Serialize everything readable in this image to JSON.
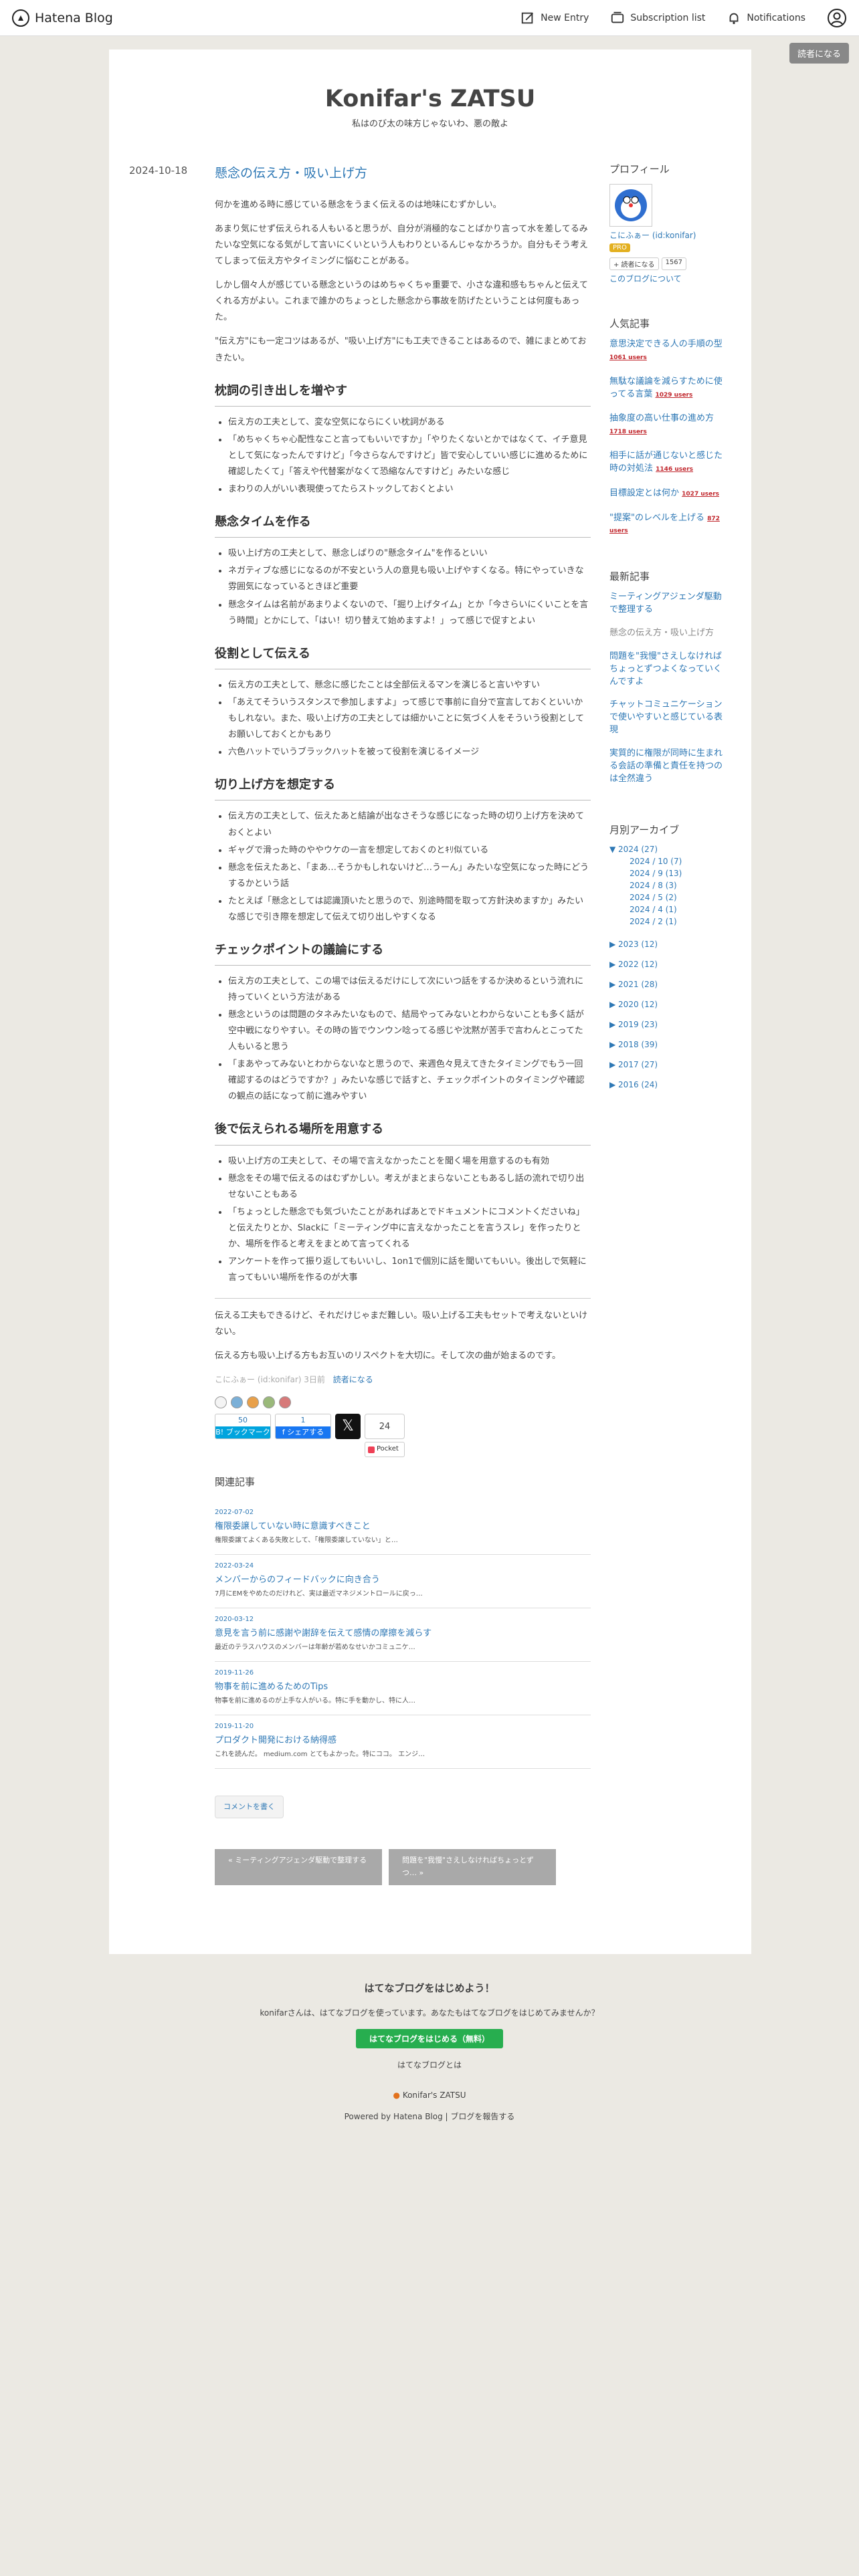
{
  "topbar": {
    "logo": "Hatena Blog",
    "new_entry": "New Entry",
    "subscription": "Subscription list",
    "notifications": "Notifications"
  },
  "read_button": "読者になる",
  "blog": {
    "title": "Konifar's ZATSU",
    "description": "私はのび太の味方じゃないわ、悪の敵よ"
  },
  "article": {
    "date": "2024-10-18",
    "title": "懸念の伝え方・吸い上げ方",
    "intro": [
      "何かを進める時に感じている懸念をうまく伝えるのは地味にむずかしい。",
      "あまり気にせず伝えられる人もいると思うが、自分が消極的なことばかり言って水を差してるみたいな空気になる気がして言いにくいという人もわりといるんじゃなかろうか。自分もそう考えてしまって伝え方やタイミングに悩むことがある。",
      "しかし個々人が感じている懸念というのはめちゃくちゃ重要で、小さな違和感もちゃんと伝えてくれる方がよい。これまで誰かのちょっとした懸念から事故を防げたということは何度もあった。",
      "\"伝え方\"にも一定コツはあるが、\"吸い上げ方\"にも工夫できることはあるので、雑にまとめておきたい。"
    ],
    "sections": [
      {
        "heading": "枕詞の引き出しを増やす",
        "items": [
          "伝え方の工夫として、変な空気にならにくい枕詞がある",
          "「めちゃくちゃ心配性なこと言ってもいいですか」「やりたくないとかではなくて、イチ意見として気になったんですけど」「今さらなんですけど」皆で安心していい感じに進めるために確認したくて」「答えや代替案がなくて恐縮なんですけど」みたいな感じ",
          "まわりの人がいい表現使ってたらストックしておくとよい"
        ]
      },
      {
        "heading": "懸念タイムを作る",
        "items": [
          "吸い上げ方の工夫として、懸念しばりの\"懸念タイム\"を作るといい",
          "ネガティブな感じになるのが不安という人の意見も吸い上げやすくなる。特にやっていきな雰囲気になっているときほど重要",
          "懸念タイムは名前があまりよくないので、「掘り上げタイム」とか「今さらいにくいことを言う時間」とかにして、「はい！切り替えて始めますよ！」って感じで促すとよい"
        ]
      },
      {
        "heading": "役割として伝える",
        "items": [
          "伝え方の工夫として、懸念に感じたことは全部伝えるマンを演じると言いやすい",
          "「あえてそういうスタンスで参加しますよ」って感じで事前に自分で宣言しておくといいかもしれない。また、吸い上げ方の工夫としては細かいことに気づく人をそういう役割としてお願いしておくとかもあり",
          "六色ハットでいうブラックハットを被って役割を演じるイメージ"
        ]
      },
      {
        "heading": "切り上げ方を想定する",
        "items": [
          "伝え方の工夫として、伝えたあと結論が出なさそうな感じになった時の切り上げ方を決めておくとよい",
          "ギャグで滑った時のややウケの一言を想定しておくのとｷﾘ似ている",
          "懸念を伝えたあと、「まあ…そうかもしれないけど…うーん」みたいな空気になった時にどうするかという話",
          "たとえば「懸念としては認識頂いたと思うので、別途時間を取って方針決めますか」みたいな感じで引き際を想定して伝えて切り出しやすくなる"
        ]
      },
      {
        "heading": "チェックポイントの議論にする",
        "items": [
          "伝え方の工夫として、この場では伝えるだけにして次にいつ話をするか決めるという流れに持っていくという方法がある",
          "懸念というのは問題のタネみたいなもので、結局やってみないとわからないことも多く話が空中戦になりやすい。その時の皆でウンウン唸ってる感じや沈黙が苦手で言わんとこってた人もいると思う",
          "「まあやってみないとわからないなと思うので、来週色々見えてきたタイミングでもう一回確認するのはどうですか？」みたいな感じで話すと、チェックポイントのタイミングや確認の観点の話になって前に進みやすい"
        ]
      },
      {
        "heading": "後で伝えられる場所を用意する",
        "items": [
          "吸い上げ方の工夫として、その場で言えなかったことを聞く場を用意するのも有効",
          "懸念をその場で伝えるのはむずかしい。考えがまとまらないこともあるし話の流れで切り出せないこともある",
          "「ちょっとした懸念でも気づいたことがあればあとでドキュメントにコメントくださいね」と伝えたりとか、Slackに「ミーティング中に言えなかったことを言うスレ」を作ったりとか、場所を作ると考えをまとめて言ってくれる",
          "アンケートを作って振り返してもいいし、1on1で個別に話を聞いてもいい。後出しで気軽に言ってもいい場所を作るのが大事"
        ]
      }
    ],
    "outro": [
      "伝える工夫もできるけど、それだけじゃまだ難しい。吸い上げる工夫もセットで考えないといけない。",
      "伝える方も吸い上げる方もお互いのリスペクトを大切に。そして次の曲が始まるのです。"
    ],
    "author_line": "こにふぁー (id:konifar) 3日前",
    "reader_link": "読者になる",
    "share": {
      "bookmark_count": "50",
      "bookmark_label": "B! ブックマーク",
      "fb_count": "1",
      "fb_label": "f シェアする",
      "x_label": "𝕏",
      "pocket_count": "24",
      "pocket_label": "Pocket"
    },
    "related_heading": "関連記事",
    "related": [
      {
        "date": "2022-07-02",
        "title": "権限委譲していない時に意識すべきこと",
        "snippet": "権限委譲てよくある失敗として、「権限委譲していない」と…"
      },
      {
        "date": "2022-03-24",
        "title": "メンバーからのフィードバックに向き合う",
        "snippet": "7月にEMをやめたのだけれど、実は最近マネジメントロールに戻っ…"
      },
      {
        "date": "2020-03-12",
        "title": "意見を言う前に感謝や謝辞を伝えて感情の摩擦を減らす",
        "snippet": "最近のテラスハウスのメンバーは年齢が若めなせいかコミュニケ…"
      },
      {
        "date": "2019-11-26",
        "title": "物事を前に進めるためのTips",
        "snippet": "物事を前に進めるのが上手な人がいる。特に手を動かし、特に人…"
      },
      {
        "date": "2019-11-20",
        "title": "プロダクト開発における納得感",
        "snippet": "これを読んだ。 medium.com とてもよかった。特にココ。 エンジ…"
      }
    ],
    "comment_button": "コメントを書く",
    "prev": "« ミーティングアジェンダ駆動で整理する",
    "next": "問題を\"我慢\"さえしなければちょっとずつ… »"
  },
  "sidebar": {
    "profile_heading": "プロフィール",
    "profile_name": "こにふぁー (id:konifar)",
    "pro_badge": "PRO",
    "follow_label": "+ 読者になる",
    "follow_count": "1567",
    "about_link": "このブログについて",
    "popular_heading": "人気記事",
    "popular": [
      {
        "title": "意思決定できる人の手順の型",
        "users": "1061 users"
      },
      {
        "title": "無駄な議論を減らすために使ってる言葉",
        "users": "1029 users"
      },
      {
        "title": "抽象度の高い仕事の進め方",
        "users": "1718 users"
      },
      {
        "title": "相手に話が通じないと感じた時の対処法",
        "users": "1146 users"
      },
      {
        "title": "目標設定とは何か",
        "users": "1027 users"
      },
      {
        "title": "\"提案\"のレベルを上げる",
        "users": "872 users"
      }
    ],
    "recent_heading": "最新記事",
    "recent": [
      "ミーティングアジェンダ駆動で整理する",
      "懸念の伝え方・吸い上げ方",
      "問題を\"我慢\"さえしなければちょっとずつよくなっていくんですよ",
      "チャットコミュニケーションで使いやすいと感じている表現",
      "実質的に権限が同時に生まれる会話の準備と責任を持つのは全然違う"
    ],
    "archive_heading": "月別アーカイブ",
    "archive_open": "▼ 2024 (27)",
    "archive_months": [
      "2024 / 10 (7)",
      "2024 / 9 (13)",
      "2024 / 8 (3)",
      "2024 / 5 (2)",
      "2024 / 4 (1)",
      "2024 / 2 (1)"
    ],
    "archive_years": [
      "▶ 2023 (12)",
      "▶ 2022 (12)",
      "▶ 2021 (28)",
      "▶ 2020 (12)",
      "▶ 2019 (23)",
      "▶ 2018 (39)",
      "▶ 2017 (27)",
      "▶ 2016 (24)"
    ]
  },
  "footer": {
    "heading": "はてなブログをはじめよう！",
    "text": "konifarさんは、はてなブログを使っています。あなたもはてなブログをはじめてみませんか？",
    "cta": "はてなブログをはじめる（無料）",
    "about": "はてなブログとは",
    "blog_name": "Konifar's ZATSU",
    "powered": "Powered by Hatena Blog | ブログを報告する"
  }
}
